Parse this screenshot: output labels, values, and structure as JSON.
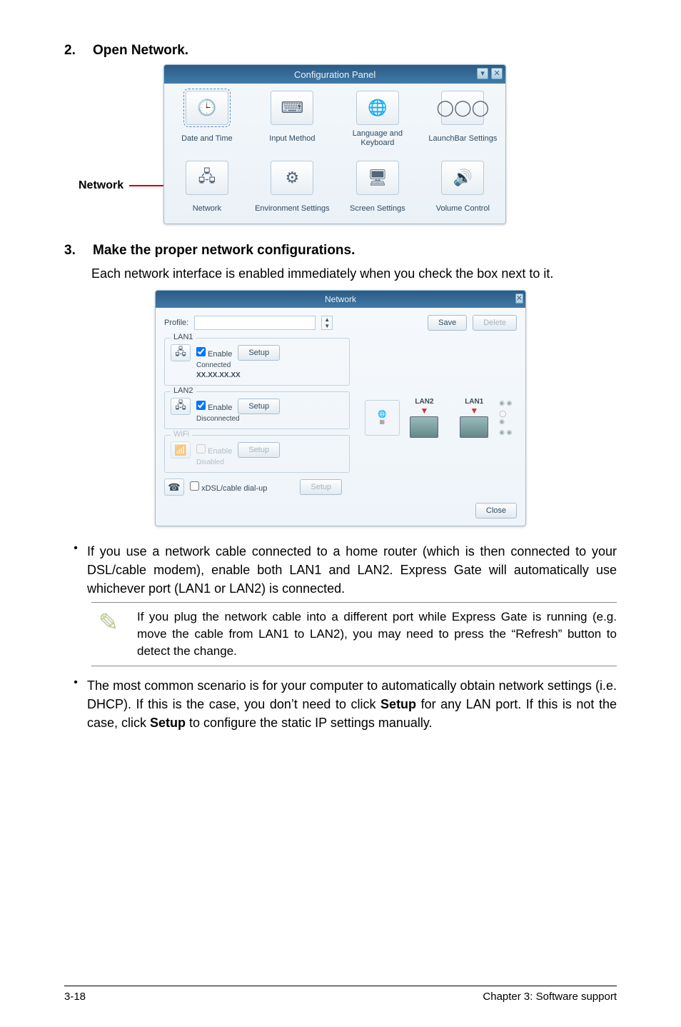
{
  "steps": {
    "s2": {
      "num": "2.",
      "title": "Open Network."
    },
    "s3": {
      "num": "3.",
      "title": "Make the proper network configurations.",
      "body": "Each network interface is enabled immediately when you check the box next to it."
    }
  },
  "fig1": {
    "pointer_label": "Network",
    "title": "Configuration Panel",
    "items": [
      {
        "label": "Date and Time",
        "glyph": "🕒",
        "name": "date-and-time-icon"
      },
      {
        "label": "Input Method",
        "glyph": "⌨",
        "name": "input-method-icon"
      },
      {
        "label": "Language and Keyboard",
        "glyph": "🌐",
        "name": "language-keyboard-icon"
      },
      {
        "label": "LaunchBar Settings",
        "glyph": "◯◯◯",
        "name": "launchbar-settings-icon"
      },
      {
        "label": "Network",
        "glyph": "🖧",
        "name": "network-icon"
      },
      {
        "label": "Environment Settings",
        "glyph": "⚙",
        "name": "environment-settings-icon"
      },
      {
        "label": "Screen Settings",
        "glyph": "🖥",
        "name": "screen-settings-icon"
      },
      {
        "label": "Volume Control",
        "glyph": "🔊",
        "name": "volume-control-icon"
      }
    ]
  },
  "fig2": {
    "title": "Network",
    "profile_label": "Profile:",
    "save_btn": "Save",
    "delete_btn": "Delete",
    "lan1": {
      "title": "LAN1",
      "enable": "Enable",
      "checked": true,
      "setup": "Setup",
      "status": "Connected",
      "ip": "XX.XX.XX.XX"
    },
    "lan2": {
      "title": "LAN2",
      "enable": "Enable",
      "checked": true,
      "setup": "Setup",
      "status": "Disconnected"
    },
    "wifi": {
      "title": "WiFi",
      "enable": "Enable",
      "checked": false,
      "setup": "Setup",
      "status": "Disabled"
    },
    "dsl": {
      "label": "xDSL/cable dial-up",
      "setup": "Setup"
    },
    "close_btn": "Close",
    "diagram": {
      "lan2": "LAN2",
      "lan1": "LAN1"
    }
  },
  "bullets": {
    "b1": "If you use a network cable connected to a home router (which is then connected to your DSL/cable modem), enable both LAN1 and LAN2. Express Gate  will automatically use whichever port (LAN1 or LAN2) is connected.",
    "note": "If you plug the network cable into a different port while Express Gate  is running (e.g. move the cable from LAN1 to LAN2), you may need to press the “Refresh” button to detect the change.",
    "b2_pre": "The most common scenario is for your computer to automatically obtain network settings (i.e. DHCP). If this is the case, you don’t need to click ",
    "b2_setup1": "Setup",
    "b2_mid": " for any LAN port. If this is not the case, click ",
    "b2_setup2": "Setup",
    "b2_post": " to configure the static IP settings manually."
  },
  "footer": {
    "left": "3-18",
    "right": "Chapter 3: Software support"
  }
}
